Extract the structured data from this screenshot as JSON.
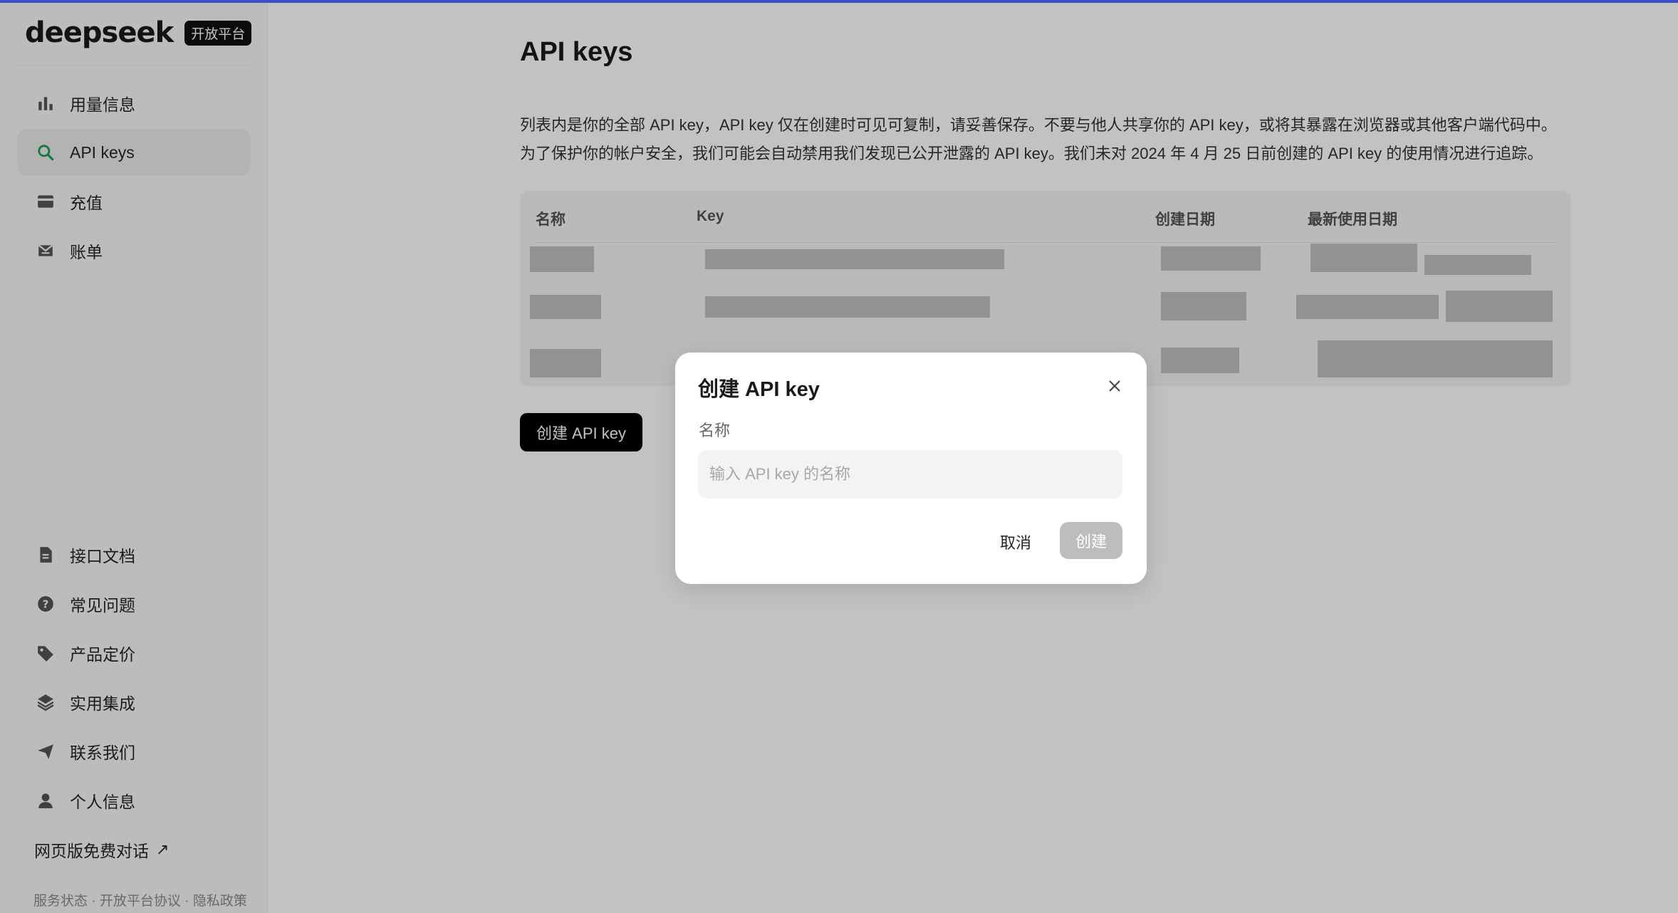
{
  "brand": {
    "name": "deepseek",
    "badge": "开放平台"
  },
  "sidebar": {
    "top_items": [
      {
        "label": "用量信息",
        "icon": "bar-chart-icon"
      },
      {
        "label": "API keys",
        "icon": "search-icon",
        "active": true
      },
      {
        "label": "充值",
        "icon": "wallet-icon"
      },
      {
        "label": "账单",
        "icon": "receipt-icon"
      }
    ],
    "bottom_items": [
      {
        "label": "接口文档",
        "icon": "document-icon"
      },
      {
        "label": "常见问题",
        "icon": "question-icon"
      },
      {
        "label": "产品定价",
        "icon": "tag-icon"
      },
      {
        "label": "实用集成",
        "icon": "layers-icon"
      },
      {
        "label": "联系我们",
        "icon": "send-icon"
      },
      {
        "label": "个人信息",
        "icon": "user-icon"
      }
    ],
    "web_chat": "网页版免费对话",
    "web_chat_arrow": "↗",
    "footer": {
      "status": "服务状态",
      "sep": " · ",
      "agreement": "开放平台协议",
      "privacy": "隐私政策"
    }
  },
  "main": {
    "title": "API keys",
    "description_line1": "列表内是你的全部 API key，API key 仅在创建时可见可复制，请妥善保存。不要与他人共享你的 API key，或将其暴露在浏览器或其他客户端代码中。",
    "description_line2": "为了保护你的帐户安全，我们可能会自动禁用我们发现已公开泄露的 API key。我们未对 2024 年 4 月 25 日前创建的 API key 的使用情况进行追踪。",
    "table": {
      "headers": [
        "名称",
        "Key",
        "创建日期",
        "最新使用日期"
      ]
    },
    "create_button": "创建 API key"
  },
  "modal": {
    "title": "创建 API key",
    "name_label": "名称",
    "name_placeholder": "输入 API key 的名称",
    "name_value": "",
    "cancel": "取消",
    "submit": "创建"
  },
  "colors": {
    "accent": "#4d6bfe",
    "active_icon": "#16a34a",
    "primary_button": "#000000",
    "disabled_button": "#bdbdbd"
  }
}
